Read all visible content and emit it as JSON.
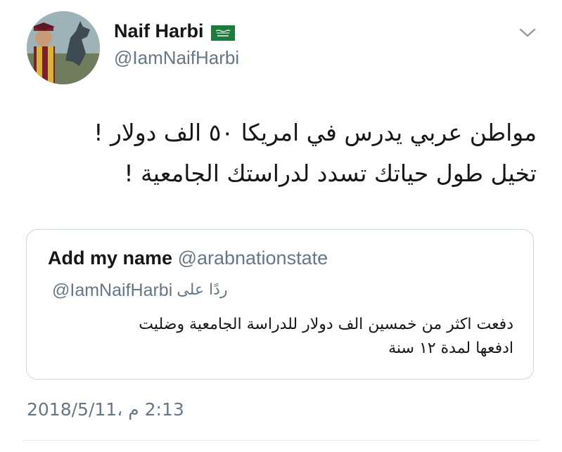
{
  "author": {
    "display_name": "Naif Harbi",
    "handle": "@IamNaifHarbi",
    "flag_icon": "saudi-flag-icon",
    "avatar": "graduate-with-horse-statue-avatar"
  },
  "menu_icon": "chevron-down-icon",
  "tweet": {
    "text": "مواطن عربي يدرس في امريكا ٥٠ الف دولار !\nتخيل طول حياتك تسدد لدراستك الجامعية !",
    "timestamp": "2:13 م ،2018/5/11"
  },
  "quoted_tweet": {
    "name": "Add my name",
    "handle": "@arabnationstate",
    "reply_to_label": "ردًا على",
    "reply_to_handle": "@IamNaifHarbi",
    "text": "دفعت اكثر من خمسين الف دولار للدراسة الجامعية وضليت\nادفعها لمدة ١٢ سنة"
  },
  "colors": {
    "primary_text": "#14171a",
    "secondary_text": "#657786",
    "border": "#ccd6dd",
    "flag_green": "#1f7a3d"
  }
}
